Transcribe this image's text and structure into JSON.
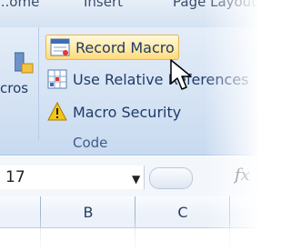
{
  "tabs": [
    "...ome",
    "Insert",
    "Page Layout"
  ],
  "macros_group": {
    "partial_label": "cros",
    "commands": [
      {
        "label": "Record Macro",
        "icon": "record-macro-icon",
        "state": "hover"
      },
      {
        "label": "Use Relative References",
        "icon": "relative-references-icon",
        "state": "normal"
      },
      {
        "label": "Macro Security",
        "icon": "warning-icon",
        "state": "normal"
      }
    ],
    "group_label": "Code"
  },
  "formula_bar": {
    "namebox_value": "17",
    "fx_label": "fx"
  },
  "columns": [
    "B",
    "C"
  ],
  "colors": {
    "ribbon": "#d5e3f4",
    "hover_fill": "#ffe9a3",
    "hover_border": "#e2b55a",
    "text": "#1f3b66"
  }
}
